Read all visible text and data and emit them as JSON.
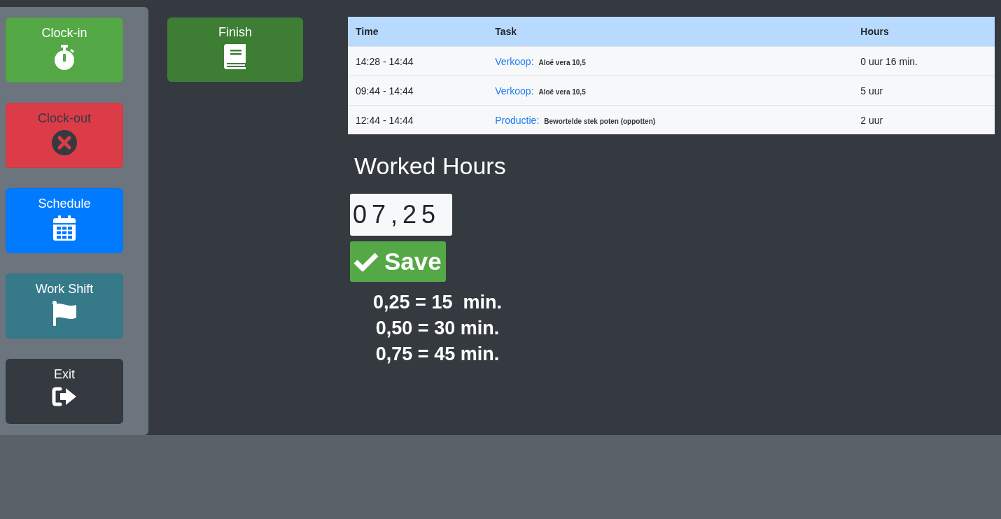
{
  "sidebar": {
    "buttons": [
      {
        "label": "Clock-in",
        "kind": "clock-in",
        "color": "#54a846"
      },
      {
        "label": "Clock-out",
        "kind": "clock-out",
        "color": "#dc3c47"
      },
      {
        "label": "Schedule",
        "kind": "schedule",
        "color": "#007bff"
      },
      {
        "label": "Work Shift",
        "kind": "work-shift",
        "color": "#367a8a"
      },
      {
        "label": "Exit",
        "kind": "exit",
        "color": "#343a40"
      }
    ]
  },
  "finish_button": {
    "label": "Finish"
  },
  "table": {
    "columns": [
      "Time",
      "Task",
      "Hours"
    ],
    "rows": [
      {
        "time": "14:28 - 14:44",
        "category": "Verkoop:",
        "task": "Aloë vera 10,5",
        "hours": "0 uur 16 min."
      },
      {
        "time": "09:44 - 14:44",
        "category": "Verkoop:",
        "task": "Aloë vera 10,5",
        "hours": "5 uur"
      },
      {
        "time": "12:44 - 14:44",
        "category": "Productie:",
        "task": "Bewortelde stek poten (oppotten)",
        "hours": "2 uur"
      }
    ]
  },
  "worked_hours": {
    "title": "Worked Hours",
    "value": "07,25",
    "save_label": "Save",
    "conversions": [
      "0,25 = 15  min.",
      "0,50 = 30 min.",
      "0,75 = 45 min."
    ]
  }
}
